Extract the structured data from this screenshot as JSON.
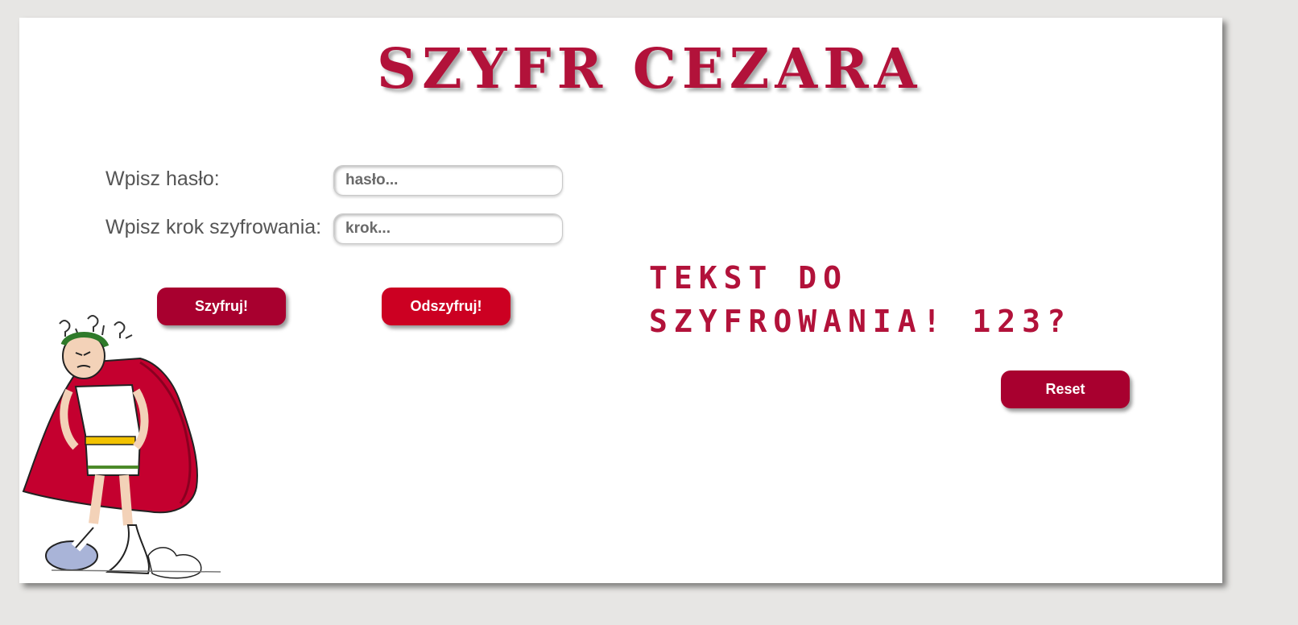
{
  "app": {
    "title": "SZYFR CEZARA"
  },
  "form": {
    "password_label": "Wpisz hasło:",
    "password_placeholder": "hasło...",
    "password_value": "",
    "step_label": "Wpisz krok szyfrowania:",
    "step_placeholder": "krok...",
    "step_value": ""
  },
  "buttons": {
    "encrypt": "Szyfruj!",
    "decrypt": "Odszyfruj!",
    "reset": "Reset"
  },
  "output": {
    "text": "Tekst do szyfrowania! 123?"
  },
  "colors": {
    "accent": "#b2123a",
    "button_encrypt": "#a8002f",
    "button_decrypt": "#cc0022",
    "button_reset": "#a8002f",
    "background": "#e7e6e4",
    "card": "#ffffff"
  },
  "illustration": {
    "icon": "julius-caesar-cartoon"
  }
}
